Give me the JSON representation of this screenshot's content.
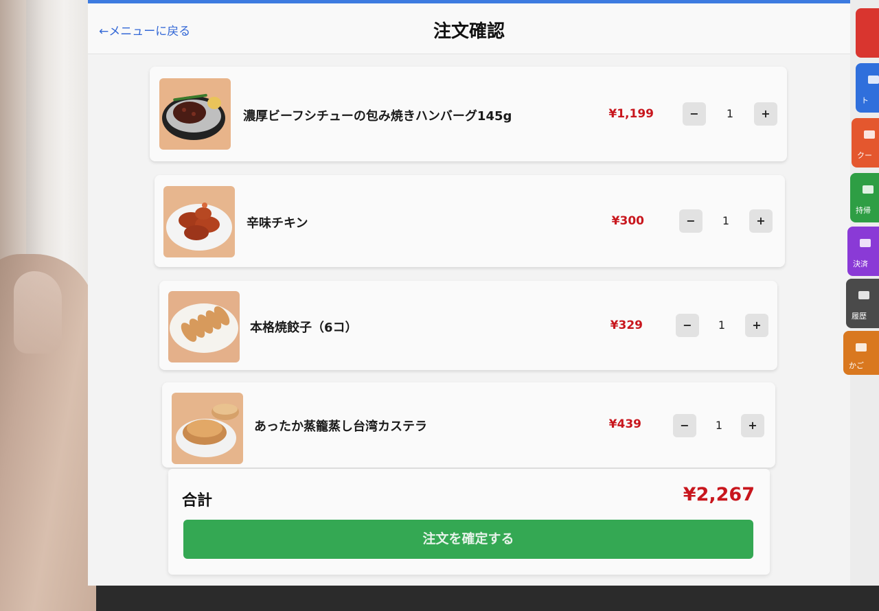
{
  "header": {
    "back_label": "←メニューに戻る",
    "title": "注文確認"
  },
  "items": [
    {
      "name": "濃厚ビーフシチューの包み焼きハンバーグ145g",
      "price": "¥1,199",
      "qty": "1"
    },
    {
      "name": "辛味チキン",
      "price": "¥300",
      "qty": "1"
    },
    {
      "name": "本格焼餃子（6コ）",
      "price": "¥329",
      "qty": "1"
    },
    {
      "name": "あったか蒸籠蒸し台湾カステラ",
      "price": "¥439",
      "qty": "1"
    }
  ],
  "qty_controls": {
    "minus": "−",
    "plus": "+"
  },
  "summary": {
    "total_label": "合計",
    "total_value": "¥2,267",
    "confirm_label": "注文を確定する"
  },
  "side_nav": [
    {
      "label": "",
      "color": "#d9352f"
    },
    {
      "label": "ト",
      "color": "#2f6fdc"
    },
    {
      "label": "クー",
      "color": "#e4572e"
    },
    {
      "label": "持帰",
      "color": "#2e9e44"
    },
    {
      "label": "決済",
      "color": "#8a3ad6"
    },
    {
      "label": "履歴",
      "color": "#4a4a4a"
    },
    {
      "label": "かご",
      "color": "#d9781f"
    }
  ],
  "colors": {
    "accent_price": "#c8161d",
    "confirm_button": "#34a853",
    "back_link": "#3267d6"
  }
}
